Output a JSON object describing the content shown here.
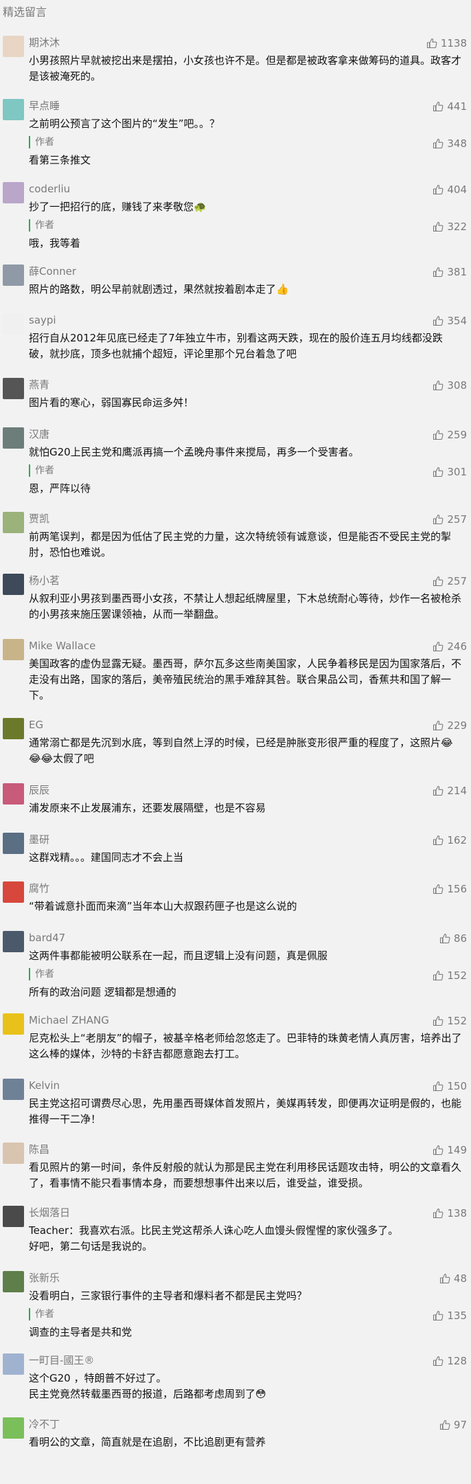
{
  "section": {
    "title": "精选留言"
  },
  "comments": [
    {
      "name": "期沐沐",
      "likes": "1138",
      "text": "小男孩照片早就被挖出来是摆拍，小女孩也许不是。但是都是被政客拿来做筹码的道具。政客才是该被淹死的。",
      "avatar_color": "#e8d5c4"
    },
    {
      "name": "早点睡",
      "likes": "441",
      "text": "之前明公预言了这个图片的“发生”吧。。？",
      "reply": {
        "tag": "作者",
        "likes": "348",
        "text": "看第三条推文"
      },
      "avatar_color": "#7ec7c2"
    },
    {
      "name": "coderliu",
      "likes": "404",
      "text": "抄了一把招行的底，赚钱了来孝敬您🐢",
      "reply": {
        "tag": "作者",
        "likes": "322",
        "text": "哦，我等着"
      },
      "avatar_color": "#b9a6c9"
    },
    {
      "name": "薛Conner",
      "likes": "381",
      "text": "照片的路数，明公早前就剧透过，果然就按着剧本走了👍",
      "avatar_color": "#8f9aa6"
    },
    {
      "name": "saypi",
      "likes": "354",
      "text": "招行自从2012年见底已经走了7年独立牛市，别看这两天跌，现在的股价连五月均线都没跌破，就抄底，顶多也就捕个超短，评论里那个兄台着急了吧",
      "avatar_color": "#f0f0f0"
    },
    {
      "name": "燕青",
      "likes": "308",
      "text": "图片看的寒心，弱国寡民命运多舛！",
      "avatar_color": "#555555"
    },
    {
      "name": "汉唐",
      "likes": "259",
      "text": "就怕G20上民主党和鹰派再搞一个孟晚舟事件来搅局，再多一个受害者。",
      "reply": {
        "tag": "作者",
        "likes": "301",
        "text": "恩，严阵以待"
      },
      "avatar_color": "#6d7d7a"
    },
    {
      "name": "贾凯",
      "likes": "257",
      "text": "前两笔误判，都是因为低估了民主党的力量，这次特统领有诚意谈，但是能否不受民主党的掣肘，恐怕也难说。",
      "avatar_color": "#9bb27a"
    },
    {
      "name": "杨小茗",
      "likes": "257",
      "text": "从叙利亚小男孩到墨西哥小女孩，不禁让人想起纸牌屋里，下木总统耐心等待，炒作一名被枪杀的小男孩来施压罢课领袖，从而一举翻盘。",
      "avatar_color": "#3e4a5a"
    },
    {
      "name": "Mike Wallace",
      "likes": "246",
      "text": "美国政客的虚伪显露无疑。墨西哥，萨尔瓦多这些南美国家，人民争着移民是因为国家落后，不走没有出路，国家的落后，美帝殖民统治的黑手难辞其咎。联合果品公司，香蕉共和国了解一下。",
      "avatar_color": "#c9b48a"
    },
    {
      "name": "EG",
      "likes": "229",
      "text": "通常溺亡都是先沉到水底，等到自然上浮的时候，已经是肿胀变形很严重的程度了，这照片😂😂😂太假了吧",
      "avatar_color": "#6a7a2a"
    },
    {
      "name": "辰辰",
      "likes": "214",
      "text": "浦发原来不止发展浦东，还要发展隔壁，也是不容易",
      "avatar_color": "#c85a7a"
    },
    {
      "name": "墨研",
      "likes": "162",
      "text": "这群戏精。。。建国同志才不会上当",
      "avatar_color": "#5a6e84"
    },
    {
      "name": "腐竹",
      "likes": "156",
      "text": "“带着诚意扑面而来滴”当年本山大叔跟药匣子也是这么说的",
      "avatar_color": "#d8473c"
    },
    {
      "name": "bard47",
      "likes": "86",
      "text": "这两件事都能被明公联系在一起，而且逻辑上没有问题，真是佩服",
      "reply": {
        "tag": "作者",
        "likes": "152",
        "text": "所有的政治问题 逻辑都是想通的"
      },
      "avatar_color": "#4b5a6a"
    },
    {
      "name": "Michael ZHANG",
      "likes": "152",
      "text": "尼克松头上“老朋友”的帽子，被基辛格老师给忽悠走了。巴菲特的珠黄老情人真厉害，培养出了这么棒的媒体，沙特的卡舒吉都愿意跑去打工。",
      "avatar_color": "#e8c21a"
    },
    {
      "name": "Kelvin",
      "likes": "150",
      "text": "民主党这招可谓费尽心思，先用墨西哥媒体首发照片，美媒再转发，即便再次证明是假的，也能推得一干二净！",
      "avatar_color": "#6f8196"
    },
    {
      "name": "陈昌",
      "likes": "149",
      "text": "看见照片的第一时间，条件反射般的就认为那是民主党在利用移民话题攻击特，明公的文章看久了，看事情不能只看事情本身，而要想想事件出来以后，谁受益，谁受损。",
      "avatar_color": "#d9c4b0"
    },
    {
      "name": "长烟落日",
      "likes": "138",
      "text": "Teacher：我喜欢右派。比民主党这帮杀人诛心吃人血馒头假惺惺的家伙强多了。\n好吧，第二句话是我说的。",
      "avatar_color": "#4a4a4a"
    },
    {
      "name": "张新乐",
      "likes": "48",
      "text": "没看明白，三家银行事件的主导者和爆料者不都是民主党吗？",
      "reply": {
        "tag": "作者",
        "likes": "135",
        "text": "调查的主导者是共和党"
      },
      "avatar_color": "#5f7f4a"
    },
    {
      "name": "一町目-國王®",
      "likes": "128",
      "text": "这个G20 ，特朗普不好过了。\n民主党竟然转载墨西哥的报道，后路都考虑周到了😳",
      "avatar_color": "#9fb3d1"
    },
    {
      "name": "冷不丁",
      "likes": "97",
      "text": "看明公的文章，简直就是在追剧，不比追剧更有营养",
      "avatar_color": "#7bbf5a"
    }
  ]
}
